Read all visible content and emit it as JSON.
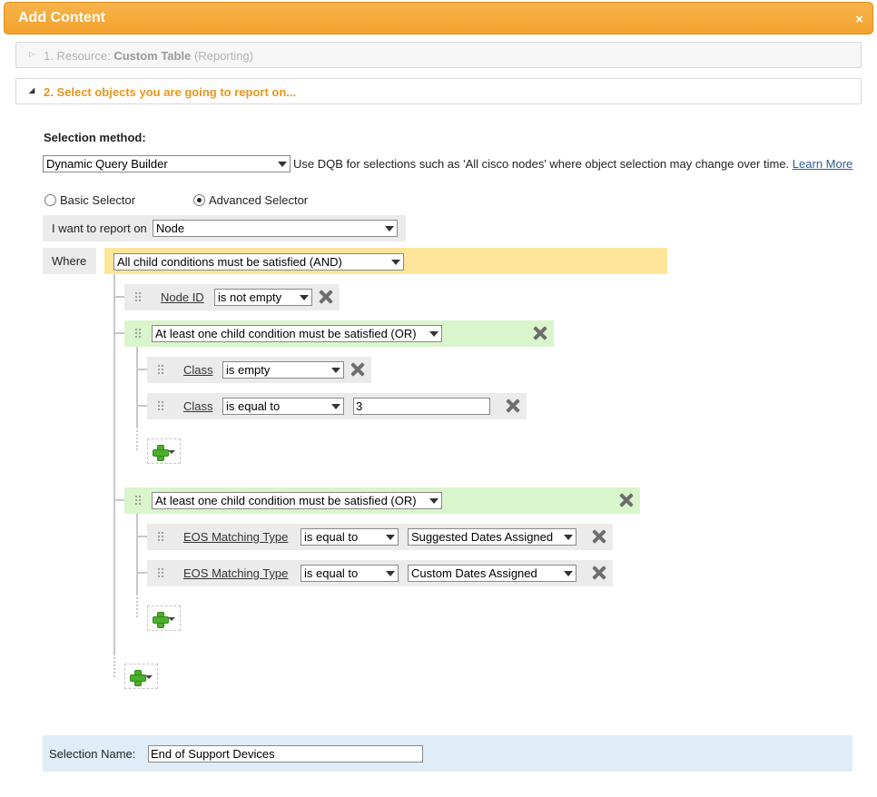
{
  "dialog": {
    "title": "Add Content",
    "close_symbol": "×"
  },
  "steps": {
    "step1": {
      "prefix": "1. Resource: ",
      "name": "Custom Table",
      "suffix": "(Reporting)"
    },
    "step2": {
      "text": "2. Select objects you are going to report on..."
    }
  },
  "selection": {
    "method_label": "Selection method:",
    "method_value": "Dynamic Query Builder",
    "method_hint": "Use DQB for selections such as 'All cisco nodes' where object selection may change over time.",
    "learn_more": "Learn More",
    "basic_selector": "Basic Selector",
    "advanced_selector": "Advanced Selector",
    "selected_mode": "advanced",
    "report_on_label": "I want to report on",
    "report_on_value": "Node",
    "where_label": "Where"
  },
  "query": {
    "root_operator": "All child conditions must be satisfied (AND)",
    "conditions": [
      {
        "field": "Node ID",
        "op": "is not empty"
      }
    ],
    "group1": {
      "operator": "At least one child condition must be satisfied (OR)",
      "rows": [
        {
          "field": "Class",
          "op": "is empty"
        },
        {
          "field": "Class",
          "op": "is equal to",
          "value": "3"
        }
      ]
    },
    "group2": {
      "operator": "At least one child condition must be satisfied (OR)",
      "rows": [
        {
          "field": "EOS Matching Type",
          "op": "is equal to",
          "value": "Suggested Dates Assigned"
        },
        {
          "field": "EOS Matching Type",
          "op": "is equal to",
          "value": "Custom Dates Assigned"
        }
      ]
    }
  },
  "name": {
    "label": "Selection Name:",
    "value": "End of Support Devices"
  },
  "colors": {
    "header": "#f3a22d",
    "accent": "#e8961f",
    "and_group": "#fde69a",
    "or_group": "#d9f5cc",
    "add_icon": "#4caf2c",
    "name_bar": "#deedf7"
  },
  "icons": [
    "close-icon",
    "expand-arrow-icon",
    "collapse-arrow-icon",
    "drag-handle-icon",
    "remove-icon",
    "add-icon",
    "dropdown-caret-icon"
  ]
}
